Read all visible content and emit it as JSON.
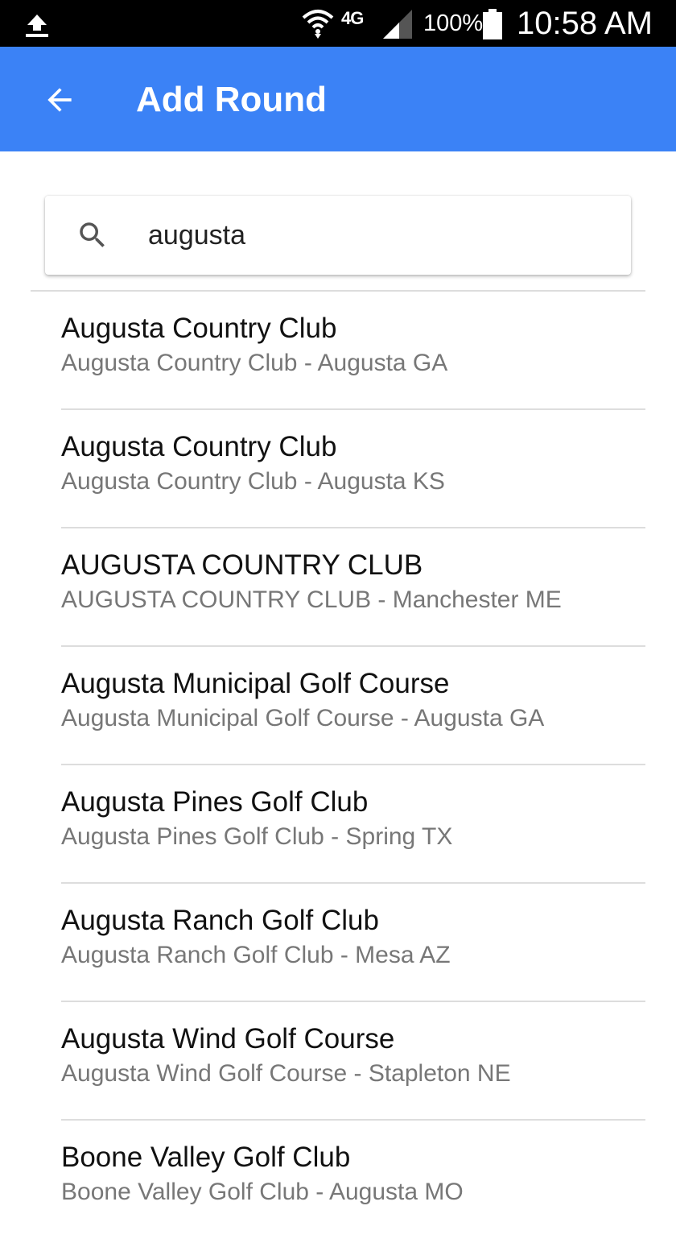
{
  "status_bar": {
    "network": "4G",
    "battery_percent": "100%",
    "time": "10:58 AM",
    "icons": [
      "upload-icon",
      "wifi-icon",
      "signal-icon",
      "battery-icon"
    ]
  },
  "app_bar": {
    "title": "Add Round",
    "back_icon": "arrow-back-icon",
    "color": "#3b82f6"
  },
  "search": {
    "value": "augusta",
    "icon": "search-icon"
  },
  "results": [
    {
      "name": "Augusta Country Club",
      "subtitle": "Augusta Country Club - Augusta GA"
    },
    {
      "name": "Augusta Country Club",
      "subtitle": "Augusta Country Club - Augusta KS"
    },
    {
      "name": "AUGUSTA COUNTRY CLUB",
      "subtitle": "AUGUSTA COUNTRY CLUB - Manchester ME"
    },
    {
      "name": "Augusta Municipal Golf Course",
      "subtitle": "Augusta Municipal Golf Course - Augusta GA"
    },
    {
      "name": "Augusta Pines Golf Club",
      "subtitle": "Augusta Pines Golf Club - Spring TX"
    },
    {
      "name": "Augusta Ranch Golf Club",
      "subtitle": "Augusta Ranch Golf Club - Mesa AZ"
    },
    {
      "name": "Augusta Wind Golf Course",
      "subtitle": "Augusta Wind Golf Course - Stapleton NE"
    },
    {
      "name": "Boone Valley Golf Club",
      "subtitle": "Boone Valley Golf Club - Augusta MO"
    }
  ]
}
